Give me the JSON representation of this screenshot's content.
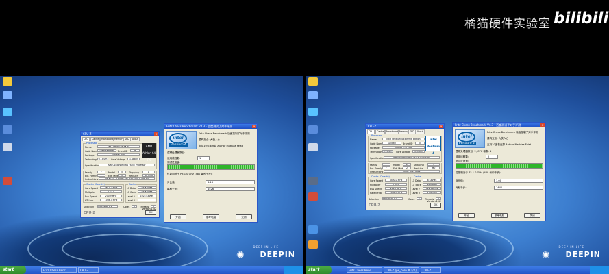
{
  "watermark": {
    "channel": "橘猫硬件实验室",
    "logo": "bilibili"
  },
  "screens": {
    "left": {
      "cpuz": {
        "title": "CPU-Z",
        "tabs": [
          "CPU",
          "Cache",
          "Mainboard",
          "Memory",
          "SPD",
          "About"
        ],
        "processor_group": "Processor",
        "name_label": "Name",
        "name_value": "AMD Athlon 64 FX-55",
        "codename_label": "Code Name",
        "codename_value": "ClawHammer",
        "brandid_label": "Brand ID",
        "brandid_value": "36",
        "package_label": "Package",
        "package_value": "Socket 939",
        "technology_label": "Technology",
        "technology_value": "0.13 um",
        "voltage_label": "Core Voltage",
        "voltage_value": "1.488 V",
        "spec_label": "Specification",
        "spec_value": "AMD Athlon(tm) 64 FX-55 Processor",
        "family_label": "Family",
        "family_value": "F",
        "model_label": "Model",
        "model_value": "5",
        "stepping_label": "Stepping",
        "stepping_value": "A",
        "extfamily_label": "Ext. Family",
        "extfamily_value": "F",
        "extmodel_label": "Ext. Model",
        "extmodel_value": "5",
        "revision_label": "Revision",
        "revision_value": "SH7-CG",
        "instr_label": "Instructions",
        "instr_value": "MMX (+), 3DNow! (+), SSE, SSE2, x86-64",
        "clocks_group": "Clocks (Core#0)",
        "corespeed_label": "Core Speed",
        "corespeed_value": "2611.2 MHz",
        "multiplier_label": "Multiplier",
        "multiplier_value": "x 13.0",
        "busspeed_label": "Bus Speed",
        "busspeed_value": "200.9 MHz",
        "htlink_label": "HT Link",
        "htlink_value": "1004.7 MHz",
        "cache_group": "Cache",
        "l1d_label": "L1 Data",
        "l1d_value": "64 KBytes",
        "l1c_label": "L1 Code",
        "l1c_value": "64 KBytes",
        "l2_label": "Level 2",
        "l2_value": "1024 KBytes",
        "l3_label": "Level 3",
        "l3_value": "",
        "selection_label": "Selection",
        "selection_value": "Processor #1",
        "cores_label": "Cores",
        "cores_value": "1",
        "threads_label": "Threads",
        "threads_value": "1",
        "chip_text": "AMD Athlon 64 FX",
        "footer": "CPU-Z",
        "version": "Version 1.42",
        "ok_label": "OK"
      },
      "fritz": {
        "title": "Fritz Chess Benchmark V4.3 - 百度测试了对手评测",
        "logo_intel": "intel",
        "logo_text": "Pentium 4",
        "line1": "Fritz Chess Benchmark 版面控制了对手评测",
        "line2": "重构支点: 大快人心",
        "line3": "支持10多核运算  Author Mathias Feist",
        "threads_prompt": "逻辑处理器数目:",
        "threads_used_label": "使用线程数:",
        "threads_used_value": "1",
        "progress_label": "测试进度窗:",
        "compare_label": "性能相对于 P3 1.0 GHz (480 每秒千步):",
        "ratio_label": "对比值:",
        "ratio_value": "3.18",
        "kn_label": "每秒千步:",
        "kn_value": "1526",
        "start_btn": "开始",
        "ref_btn": "参考电脑",
        "close_btn": "关闭"
      },
      "taskbar": {
        "start": "start",
        "tasks": [
          "Fritz Chess Benc",
          "CPU-Z"
        ],
        "tray": ""
      },
      "deepin": {
        "name": "DEEPIN",
        "tagline": "DEEP IN LIFE"
      }
    },
    "right": {
      "cpuz": {
        "title": "CPU-Z",
        "tabs": [
          "CPU",
          "Cache",
          "Mainboard",
          "Memory",
          "SPD",
          "About"
        ],
        "processor_group": "Processor",
        "name_label": "Name",
        "name_value": "Intel Pentium 4 Extreme Edition",
        "codename_label": "Code Name",
        "codename_value": "Gallatin",
        "brandid_label": "Brand ID",
        "brandid_value": "0",
        "package_label": "Package",
        "package_value": "Socket 775 LGA",
        "technology_label": "Technology",
        "technology_value": "0.13 um",
        "voltage_label": "Core Voltage",
        "voltage_value": "1.536 V",
        "spec_label": "Specification",
        "spec_value": "Intel(R) Pentium(R) 4 CPU 3.40GHz",
        "family_label": "Family",
        "family_value": "F",
        "model_label": "Model",
        "model_value": "2",
        "stepping_label": "Stepping",
        "stepping_value": "9",
        "extfamily_label": "Ext. Family",
        "extfamily_value": "F",
        "extmodel_label": "Ext. Model",
        "extmodel_value": "2",
        "revision_label": "Revision",
        "revision_value": "M0",
        "instr_label": "Instructions",
        "instr_value": "MMX, SSE, SSE2",
        "clocks_group": "Clocks (Core#0)",
        "corespeed_label": "Core Speed",
        "corespeed_value": "3400.0 MHz",
        "multiplier_label": "Multiplier",
        "multiplier_value": "x 13.0",
        "busspeed_label": "Bus Speed",
        "busspeed_value": "261.7 MHz",
        "htlink_label": "Rated FSB",
        "htlink_value": "1046.9 MHz",
        "cache_group": "Cache",
        "l1d_label": "L1 Data",
        "l1d_value": "8 KBytes",
        "l1c_label": "L1 Trace",
        "l1c_value": "12 Kuops",
        "l2_label": "Level 2",
        "l2_value": "512 KBytes",
        "l3_label": "Level 3",
        "l3_value": "2 MBytes",
        "selection_label": "Selection",
        "selection_value": "Processor #1",
        "cores_label": "Cores",
        "cores_value": "1",
        "threads_label": "Threads",
        "threads_value": "2",
        "chip_text": "intel Pentium 4",
        "footer": "CPU-Z",
        "version": "Version 1.42",
        "ok_label": "OK"
      },
      "fritz": {
        "title": "Fritz Chess Benchmark V4.3 - 百度测试了对手评测",
        "logo_intel": "intel",
        "logo_text": "Pentium 4",
        "line1": "Fritz Chess Benchmark 版面控制了对手评测",
        "line2": "重构支点: 大快人心",
        "line3": "支持10多核运算  Author Mathias Feist",
        "threads_prompt": "逻辑处理器数目: 2, CPU 核数: 1",
        "threads_used_label": "使用线程数:",
        "threads_used_value": "2",
        "progress_label": "测试进度窗:",
        "compare_label": "性能相对于 P3 1.0 GHz (480 每秒千步):",
        "ratio_label": "对比值:",
        "ratio_value": "3.00",
        "kn_label": "每秒千步:",
        "kn_value": "1440",
        "start_btn": "开始",
        "ref_btn": "参考电脑",
        "close_btn": "关闭"
      },
      "taskbar": {
        "start": "start",
        "tasks": [
          "Fritz Chess Benc",
          "CPU-Z [pe_core # 1/2]",
          "CPU-Z"
        ],
        "tray": ""
      },
      "deepin": {
        "name": "DEEPIN",
        "tagline": "DEEP IN LIFE"
      }
    }
  }
}
